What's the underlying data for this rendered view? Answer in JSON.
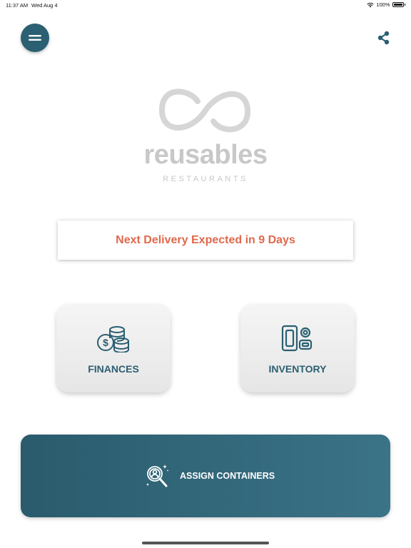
{
  "status_bar": {
    "time": "11:37 AM",
    "date": "Wed Aug 4",
    "battery": "100%"
  },
  "header": {
    "menu_icon": "hamburger-menu-icon",
    "share_icon": "share-icon"
  },
  "brand": {
    "name": "reusables",
    "subtitle": "RESTAURANTS",
    "color": "#c8c8c8"
  },
  "delivery": {
    "message": "Next Delivery Expected in 9 Days",
    "color": "#e0684d"
  },
  "tiles": [
    {
      "label": "FINANCES",
      "icon": "coins-icon"
    },
    {
      "label": "INVENTORY",
      "icon": "containers-icon"
    }
  ],
  "assign": {
    "label": "ASSIGN CONTAINERS",
    "icon": "search-user-icon"
  },
  "colors": {
    "primary": "#2b5f72",
    "accent": "#e0684d"
  }
}
